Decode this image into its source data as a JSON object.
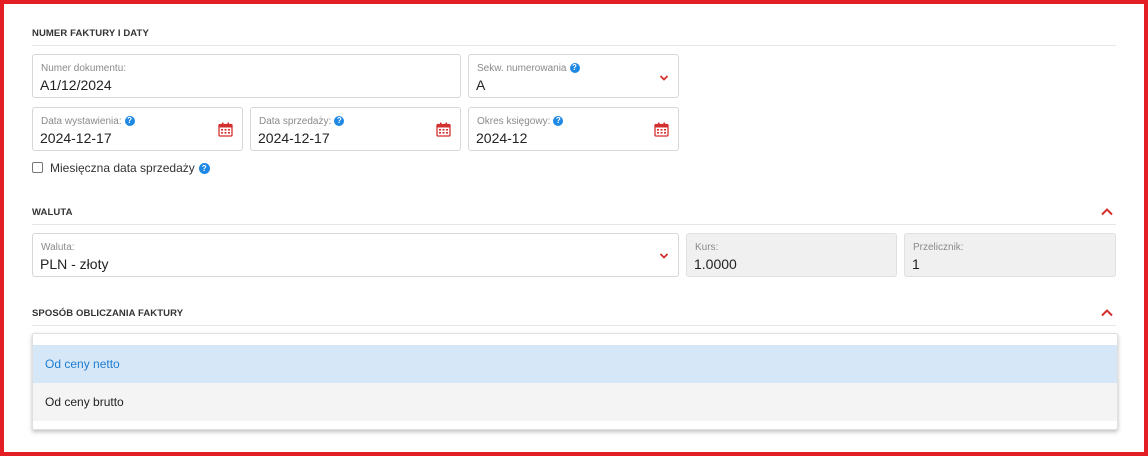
{
  "sections": {
    "numbering": {
      "title": "NUMER FAKTURY I DATY"
    },
    "currency": {
      "title": "WALUTA"
    },
    "calculation": {
      "title": "SPOSÓB OBLICZANIA FAKTURY"
    }
  },
  "fields": {
    "document_number": {
      "label": "Numer dokumentu:",
      "value": "A1/12/2024"
    },
    "numbering_sequence": {
      "label": "Sekw. numerowania",
      "value": "A"
    },
    "issue_date": {
      "label": "Data wystawienia:",
      "value": "2024-12-17"
    },
    "sale_date": {
      "label": "Data sprzedaży:",
      "value": "2024-12-17"
    },
    "accounting_period": {
      "label": "Okres księgowy:",
      "value": "2024-12"
    },
    "monthly_sale_date": {
      "label": "Miesięczna data sprzedaży",
      "checked": false
    },
    "currency": {
      "label": "Waluta:",
      "value": "PLN - złoty"
    },
    "rate": {
      "label": "Kurs:",
      "value": "1.0000"
    },
    "converter": {
      "label": "Przelicznik:",
      "value": "1"
    }
  },
  "calculation_options": [
    {
      "label": "Od ceny netto",
      "selected": true
    },
    {
      "label": "Od ceny brutto",
      "selected": false
    }
  ],
  "help_glyph": "?",
  "colors": {
    "accent_red": "#d32f2f",
    "help_blue": "#1e88e5",
    "frame_red": "#e31e24",
    "selected_bg": "#d6e8f8"
  },
  "icons": [
    "help-icon",
    "calendar-icon",
    "chevron-down-icon",
    "chevron-up-icon"
  ]
}
